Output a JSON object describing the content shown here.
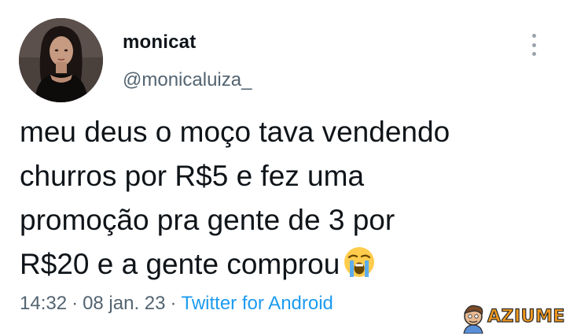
{
  "author": {
    "display_name": "monicat",
    "handle": "@monicaluiza_",
    "avatar_icon": "profile-photo"
  },
  "tweet": {
    "lines": [
      "meu deus o moço tava vendendo",
      "churros por R$5 e fez uma",
      "promoção pra gente de 3 por",
      "R$20 e a gente comprou"
    ],
    "emoji": "loudly-crying-face"
  },
  "meta": {
    "time": "14:32",
    "date": "08 jan. 23",
    "source": "Twitter for Android",
    "separator": "·"
  },
  "more_icon": "vertical-ellipsis-icon",
  "watermark": {
    "text": "AZIUME"
  },
  "colors": {
    "text": "#0f1419",
    "secondary": "#536471",
    "link": "#1d9bf0",
    "watermark": "#f39a1d"
  }
}
